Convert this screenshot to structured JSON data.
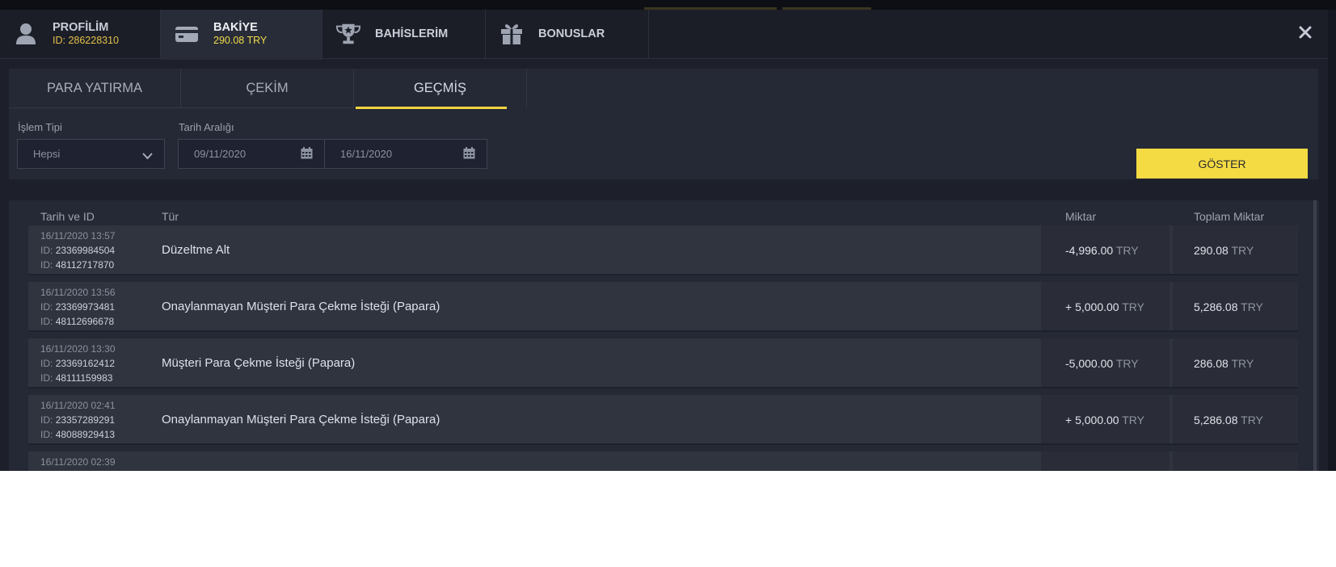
{
  "header": {
    "tabs": [
      {
        "label": "PROFİLİM",
        "sub": "ID: 286228310",
        "icon": "user-icon"
      },
      {
        "label": "BAKİYE",
        "sub": "290.08 TRY",
        "icon": "wallet-icon"
      },
      {
        "label": "BAHİSLERİM",
        "sub": "",
        "icon": "trophy-icon"
      },
      {
        "label": "BONUSLAR",
        "sub": "",
        "icon": "gift-icon"
      }
    ],
    "active_tab": "BAKİYE",
    "close_icon": "close-icon"
  },
  "subtabs": {
    "items": [
      "PARA YATIRMA",
      "ÇEKİM",
      "GEÇMİŞ"
    ],
    "active": "GEÇMİŞ"
  },
  "filters": {
    "type_label": "İşlem Tipi",
    "type_value": "Hepsi",
    "range_label": "Tarih Aralığı",
    "date_from": "09/11/2020",
    "date_to": "16/11/2020",
    "show_button": "GÖSTER"
  },
  "table": {
    "headers": {
      "date_id": "Tarih ve ID",
      "type": "Tür",
      "amount": "Miktar",
      "total": "Toplam Miktar"
    },
    "id_prefix": "ID:",
    "currency": "TRY",
    "rows": [
      {
        "datetime": "16/11/2020 13:57",
        "id1": "23369984504",
        "id2": "48112717870",
        "type": "Düzeltme Alt",
        "amount": "-4,996.00",
        "total": "290.08"
      },
      {
        "datetime": "16/11/2020 13:56",
        "id1": "23369973481",
        "id2": "48112696678",
        "type": "Onaylanmayan Müşteri Para Çekme İsteği (Papara)",
        "amount": "+ 5,000.00",
        "total": "5,286.08"
      },
      {
        "datetime": "16/11/2020 13:30",
        "id1": "23369162412",
        "id2": "48111159983",
        "type": "Müşteri Para Çekme İsteği (Papara)",
        "amount": "-5,000.00",
        "total": "286.08"
      },
      {
        "datetime": "16/11/2020 02:41",
        "id1": "23357289291",
        "id2": "48088929413",
        "type": "Onaylanmayan Müşteri Para Çekme İsteği (Papara)",
        "amount": "+ 5,000.00",
        "total": "5,286.08"
      },
      {
        "datetime": "16/11/2020 02:39",
        "id1": "",
        "id2": "",
        "type": "",
        "amount": "",
        "total": ""
      }
    ]
  },
  "colors": {
    "accent": "#f4db43",
    "id_gold": "#e4c04a",
    "background": "#1d202a"
  }
}
